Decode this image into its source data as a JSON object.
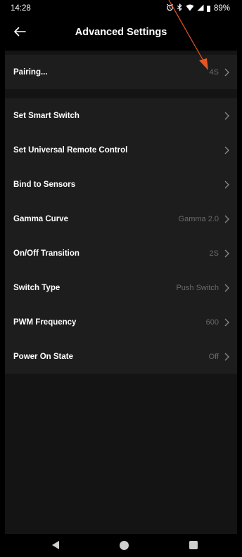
{
  "status_bar": {
    "time": "14:28",
    "battery": "89%"
  },
  "header": {
    "title": "Advanced Settings"
  },
  "groups": [
    {
      "items": [
        {
          "label": "Pairing...",
          "value": "4S"
        }
      ]
    },
    {
      "items": [
        {
          "label": "Set Smart Switch",
          "value": ""
        },
        {
          "label": "Set Universal Remote Control",
          "value": ""
        },
        {
          "label": "Bind to Sensors",
          "value": ""
        },
        {
          "label": "Gamma Curve",
          "value": "Gamma 2.0"
        },
        {
          "label": "On/Off Transition",
          "value": "2S"
        },
        {
          "label": "Switch Type",
          "value": "Push Switch"
        },
        {
          "label": "PWM Frequency",
          "value": "600"
        },
        {
          "label": "Power On State",
          "value": "Off"
        }
      ]
    }
  ],
  "colors": {
    "background": "#141414",
    "group_background": "#1d1d1d",
    "value_text": "#6a6a6a",
    "annotation_arrow": "#e8541f"
  },
  "icons": {
    "back": "arrow-left-icon",
    "chevron": "chevron-right-icon",
    "alarm": "alarm-icon",
    "bluetooth": "bluetooth-icon",
    "wifi": "wifi-icon",
    "signal": "cell-signal-icon",
    "battery": "battery-icon"
  }
}
